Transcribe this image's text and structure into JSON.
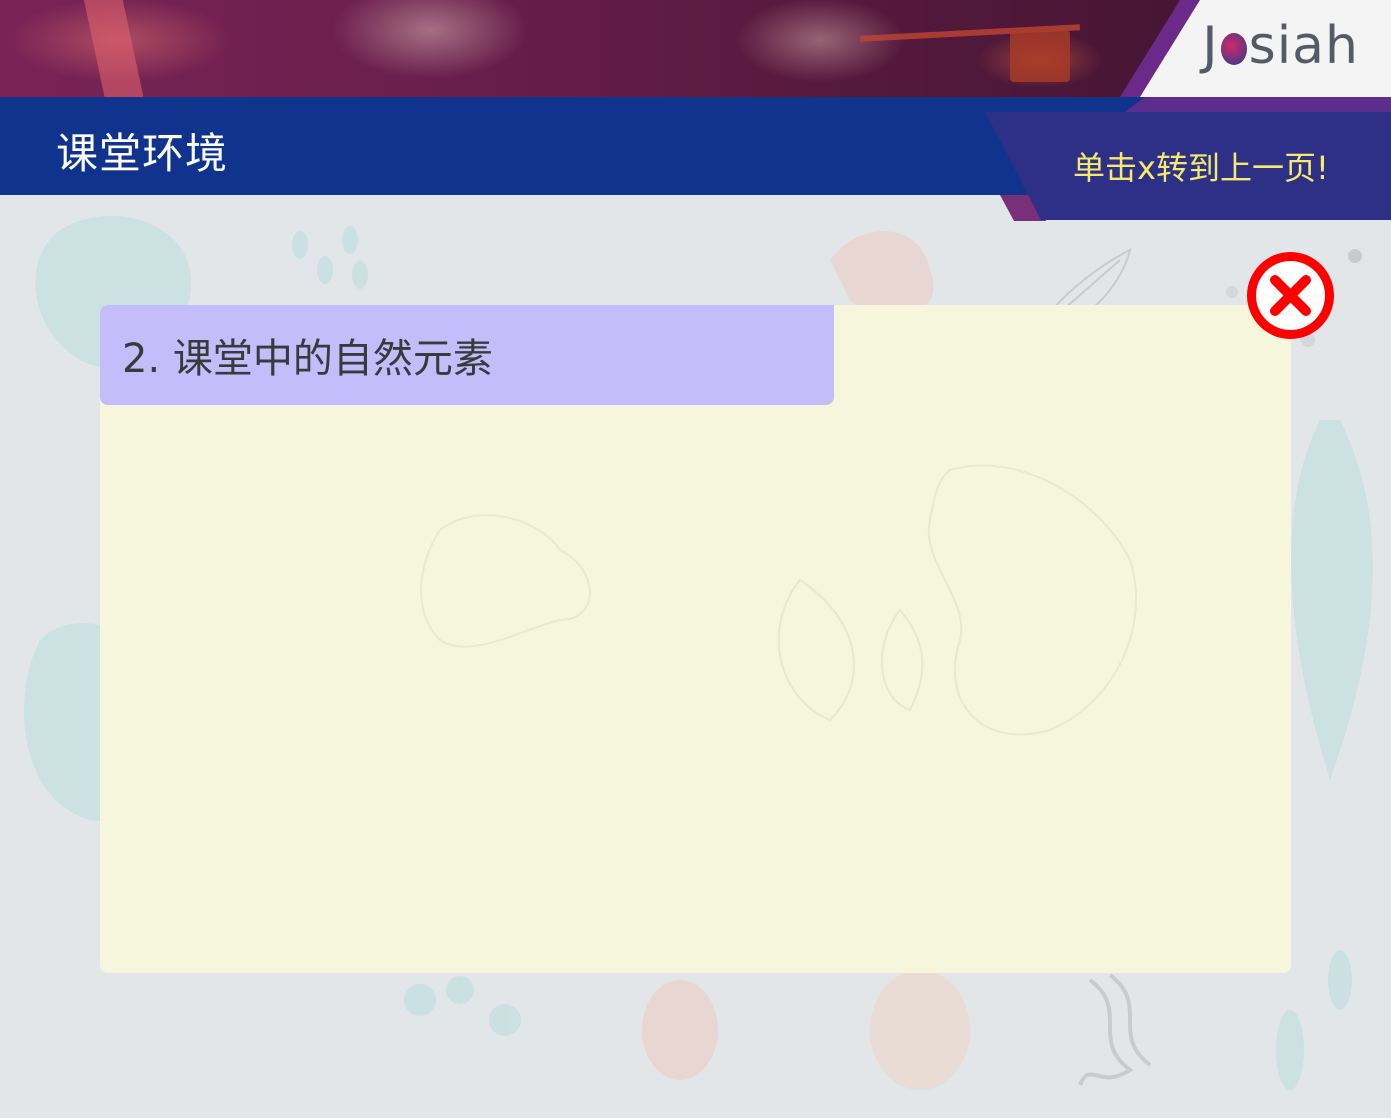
{
  "header": {
    "title": "课堂环境",
    "hint": "单击x转到上一页!"
  },
  "logo": {
    "text_before": "J",
    "text_after": "siah"
  },
  "card": {
    "tab_label": "2. 课堂中的自然元素"
  },
  "icons": {
    "close": "close-icon"
  },
  "colors": {
    "header_bar": "#10338e",
    "hint_banner": "#2e2f86",
    "hint_text": "#f4ea6c",
    "card_bg": "#f6f6dc",
    "tab_bg": "#c4bcfb",
    "close_red": "#ff0000",
    "page_bg": "#e3e6e8"
  }
}
